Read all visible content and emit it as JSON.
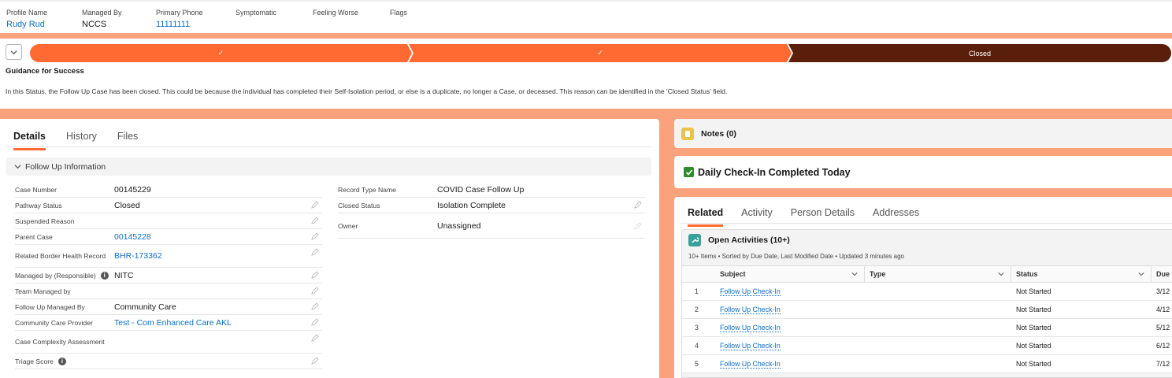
{
  "highlights": [
    {
      "label": "Profile Name",
      "value": "Rudy Rud",
      "link": true
    },
    {
      "label": "Managed By",
      "value": "NCCS",
      "link": false
    },
    {
      "label": "Primary Phone",
      "value": "11111111",
      "link": true
    },
    {
      "label": "Symptomatic",
      "value": "",
      "link": false
    },
    {
      "label": "Feeling Worse",
      "value": "",
      "link": false
    },
    {
      "label": "Flags",
      "value": "",
      "link": false
    }
  ],
  "path": {
    "stages": [
      {
        "label": "✓",
        "state": "complete"
      },
      {
        "label": "✓",
        "state": "complete"
      },
      {
        "label": "Closed",
        "state": "current"
      }
    ],
    "guidance_title": "Guidance for Success",
    "guidance_text": "In this Status, the Follow Up Case has been closed. This could be because the individual has completed their Self-Isolation period, or else is a duplicate, no longer a Case, or deceased. This reason can be identified in the 'Closed Status' field."
  },
  "details": {
    "tabs": [
      "Details",
      "History",
      "Files"
    ],
    "active_tab": "Details",
    "section_title": "Follow Up Information",
    "left_fields": [
      {
        "label": "Case Number",
        "value": "00145229"
      },
      {
        "label": "Pathway Status",
        "value": "Closed"
      },
      {
        "label": "Suspended Reason",
        "value": ""
      },
      {
        "label": "Parent Case",
        "value": "00145228"
      },
      {
        "label": "Related Border Health Record",
        "value": "BHR-173362"
      },
      {
        "label": "Managed by (Responsible)",
        "value": "NITC"
      },
      {
        "label": "Team Managed by",
        "value": ""
      },
      {
        "label": "Follow Up Managed By",
        "value": "Community Care"
      },
      {
        "label": "Community Care Provider",
        "value": "Test - Com Enhanced Care AKL"
      },
      {
        "label": "Case Complexity Assessment",
        "value": ""
      },
      {
        "label": "Triage Score",
        "value": ""
      }
    ],
    "right_fields": [
      {
        "label": "Record Type Name",
        "value": "COVID Case Follow Up"
      },
      {
        "label": "Closed Status",
        "value": "Isolation Complete"
      },
      {
        "label": "Owner",
        "value": "Unassigned"
      }
    ],
    "info_icon": "i"
  },
  "notes": {
    "title": "Notes (0)"
  },
  "checkin": {
    "title": "Daily Check-In Completed Today"
  },
  "related": {
    "tabs": [
      "Related",
      "Activity",
      "Person Details",
      "Addresses"
    ],
    "active_tab": "Related",
    "open_activities": {
      "title": "Open Activities (10+)",
      "subtitle": "10+ Items • Sorted by Due Date, Last Modified Date • Updated 3 minutes ago",
      "columns": [
        "Subject",
        "Type",
        "Status",
        "Due"
      ],
      "rows": [
        {
          "num": "1",
          "subject": "Follow Up Check-In",
          "type": "",
          "status": "Not Started",
          "due": "3/12"
        },
        {
          "num": "2",
          "subject": "Follow Up Check-In",
          "type": "",
          "status": "Not Started",
          "due": "4/12"
        },
        {
          "num": "3",
          "subject": "Follow Up Check-In",
          "type": "",
          "status": "Not Started",
          "due": "5/12"
        },
        {
          "num": "4",
          "subject": "Follow Up Check-In",
          "type": "",
          "status": "Not Started",
          "due": "6/12"
        },
        {
          "num": "5",
          "subject": "Follow Up Check-In",
          "type": "",
          "status": "Not Started",
          "due": "7/12"
        }
      ]
    }
  },
  "colors": {
    "path_complete": "#fe6a32",
    "path_current": "#5a1f0a",
    "accent": "#fe6a32",
    "link": "#0b6ec5",
    "background": "#f9a27c"
  }
}
